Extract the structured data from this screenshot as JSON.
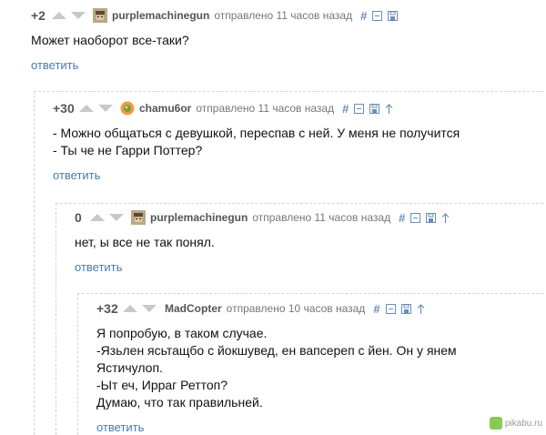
{
  "common": {
    "sent_label": "отправлено",
    "reply_label": "ответить",
    "link_symbol": "#"
  },
  "colors": {
    "link": "#4a7ba7",
    "icon": "#6c8fb3",
    "meta": "#777777",
    "thread_line": "#d4d4d4"
  },
  "comments": [
    {
      "rating": "+2",
      "username": "purplemachinegun",
      "time": "11 часов назад",
      "avatar_icon": "pixel-avatar-icon",
      "lines": [
        "Может наоборот все-таки?"
      ]
    },
    {
      "rating": "+30",
      "username": "chamu6or",
      "time": "11 часов назад",
      "avatar_icon": "orange-avatar-icon",
      "lines": [
        "- Можно общаться с девушкой, переспав с ней. У меня не получится",
        "- Ты че не Гарри Поттер?"
      ]
    },
    {
      "rating": "0",
      "username": "purplemachinegun",
      "time": "11 часов назад",
      "avatar_icon": "pixel-avatar-icon",
      "lines": [
        "нет, ы все не так понял."
      ]
    },
    {
      "rating": "+32",
      "username": "MadCopter",
      "time": "10 часов назад",
      "avatar_icon": "",
      "lines": [
        "Я попробую, в таком случае.",
        "-Язьлен ясьтащбо с йокшувед, ен вапсереп с йен. Он у янем",
        "Ястичулоп.",
        "-Ыт еч, Ирраг Реттоп?",
        "Думаю, что так правильней."
      ]
    }
  ],
  "watermark": {
    "text": "pikabu.ru",
    "icon": "pikabu-logo-icon"
  }
}
